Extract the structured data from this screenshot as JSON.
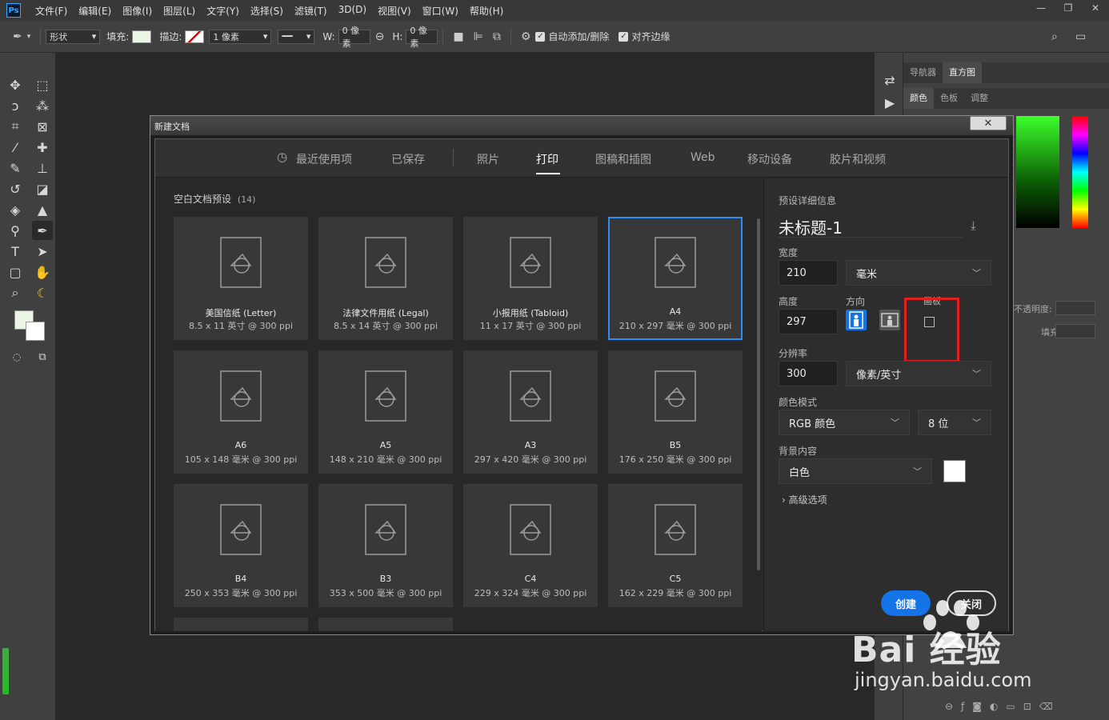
{
  "menubar": {
    "logo": "Ps",
    "items": [
      "文件(F)",
      "编辑(E)",
      "图像(I)",
      "图层(L)",
      "文字(Y)",
      "选择(S)",
      "滤镜(T)",
      "3D(D)",
      "视图(V)",
      "窗口(W)",
      "帮助(H)"
    ],
    "window_controls": [
      "minimize-icon",
      "restore-icon",
      "close-icon"
    ]
  },
  "options_bar": {
    "mode": "形状",
    "fill_label": "填充:",
    "stroke_label": "描边:",
    "stroke_width": "1 像素",
    "w_label": "W:",
    "w_value": "0 像素",
    "h_label": "H:",
    "h_value": "0 像素",
    "auto_add_label": "自动添加/删除",
    "align_edges_label": "对齐边缘",
    "fill_color": "#eaf5e6"
  },
  "right_panels": {
    "top_tabs": [
      "导航器",
      "直方图"
    ],
    "color_tabs": [
      "颜色",
      "色板",
      "调整"
    ],
    "opacity_label": "不透明度:",
    "fill_label": "填充:"
  },
  "dialog": {
    "title": "新建文档",
    "tabs": [
      {
        "label": "最近使用项",
        "icon": "clock-icon"
      },
      {
        "label": "已保存"
      },
      {
        "label": "照片"
      },
      {
        "label": "打印",
        "active": true
      },
      {
        "label": "图稿和插图"
      },
      {
        "label": "Web"
      },
      {
        "label": "移动设备"
      },
      {
        "label": "胶片和视频"
      }
    ],
    "presets_header": "空白文档预设",
    "presets_count": "(14)",
    "presets": [
      {
        "name": "美国信纸 (Letter)",
        "size": "8.5 x 11 英寸 @ 300 ppi"
      },
      {
        "name": "法律文件用纸 (Legal)",
        "size": "8.5 x 14 英寸 @ 300 ppi"
      },
      {
        "name": "小报用纸 (Tabloid)",
        "size": "11 x 17 英寸 @ 300 ppi"
      },
      {
        "name": "A4",
        "size": "210 x 297 毫米 @ 300 ppi",
        "selected": true
      },
      {
        "name": "A6",
        "size": "105 x 148 毫米 @ 300 ppi"
      },
      {
        "name": "A5",
        "size": "148 x 210 毫米 @ 300 ppi"
      },
      {
        "name": "A3",
        "size": "297 x 420 毫米 @ 300 ppi"
      },
      {
        "name": "B5",
        "size": "176 x 250 毫米 @ 300 ppi"
      },
      {
        "name": "B4",
        "size": "250 x 353 毫米 @ 300 ppi"
      },
      {
        "name": "B3",
        "size": "353 x 500 毫米 @ 300 ppi"
      },
      {
        "name": "C4",
        "size": "229 x 324 毫米 @ 300 ppi"
      },
      {
        "name": "C5",
        "size": "162 x 229 毫米 @ 300 ppi"
      }
    ],
    "details": {
      "header": "预设详细信息",
      "doc_name": "未标题-1",
      "width_label": "宽度",
      "width_value": "210",
      "width_unit": "毫米",
      "height_label": "高度",
      "height_value": "297",
      "orientation_label": "方向",
      "artboard_label": "画板",
      "resolution_label": "分辨率",
      "resolution_value": "300",
      "resolution_unit": "像素/英寸",
      "color_mode_label": "颜色模式",
      "color_mode_value": "RGB 颜色",
      "bit_depth": "8 位",
      "background_label": "背景内容",
      "background_value": "白色",
      "advanced_label": "高级选项",
      "create_button": "创建",
      "close_button": "关闭",
      "accent_color": "#1473e6",
      "highlight_color": "#e02020"
    }
  },
  "watermark": {
    "brand": "Bai  经验",
    "url": "jingyan.baidu.com"
  }
}
